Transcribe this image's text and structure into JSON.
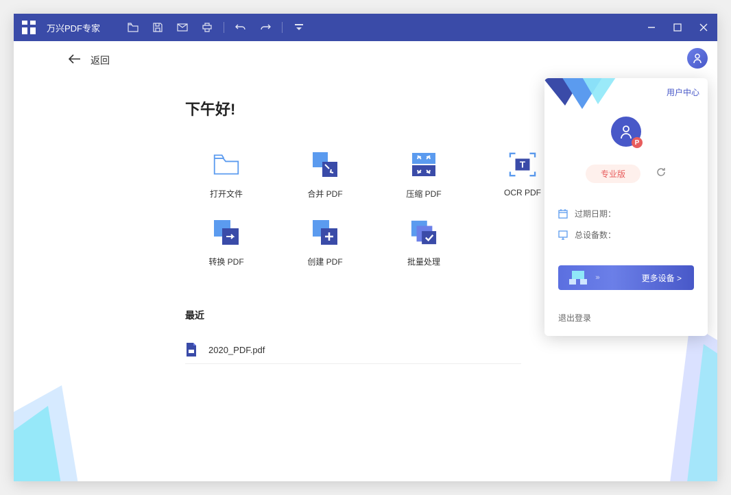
{
  "app": {
    "title": "万兴PDF专家"
  },
  "back": {
    "label": "返回"
  },
  "greeting": "下午好!",
  "actions": [
    {
      "id": "open-file",
      "label": "打开文件"
    },
    {
      "id": "merge-pdf",
      "label": "合并 PDF"
    },
    {
      "id": "compress-pdf",
      "label": "压缩 PDF"
    },
    {
      "id": "ocr-pdf",
      "label": "OCR PDF"
    },
    {
      "id": "convert-pdf",
      "label": "转换 PDF"
    },
    {
      "id": "create-pdf",
      "label": "创建 PDF"
    },
    {
      "id": "batch-process",
      "label": "批量处理"
    }
  ],
  "recent": {
    "title": "最近",
    "items": [
      {
        "name": "2020_PDF.pdf"
      }
    ]
  },
  "userPanel": {
    "userCenter": "用户中心",
    "proLabel": "专业版",
    "avatarBadge": "P",
    "expiry": {
      "label": "过期日期："
    },
    "devices": {
      "label": "总设备数："
    },
    "moreDevices": "更多设备 >",
    "logout": "退出登录"
  }
}
